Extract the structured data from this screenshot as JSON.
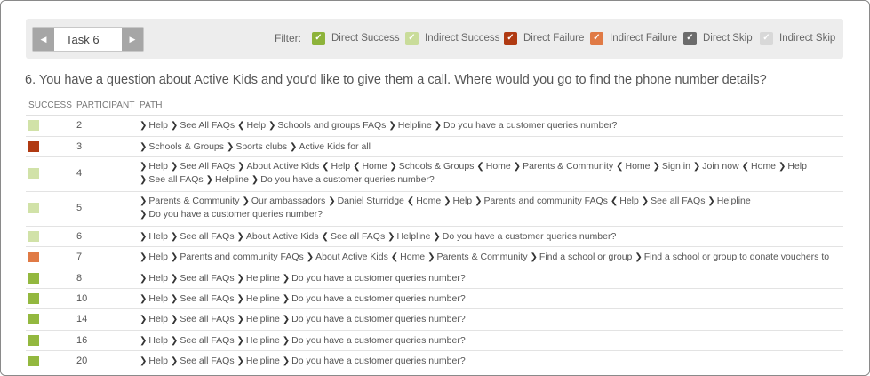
{
  "toolbar": {
    "prev_icon": "chevron-left-icon",
    "next_icon": "chevron-right-icon",
    "task_label": "Task 6",
    "filter_label": "Filter:",
    "filters": [
      {
        "label": "Direct Success",
        "color": "#8db33a",
        "checked": true
      },
      {
        "label": "Indirect Success",
        "color": "#c9dc9a",
        "checked": true
      },
      {
        "label": "Direct Failure",
        "color": "#b03a12",
        "checked": true
      },
      {
        "label": "Indirect Failure",
        "color": "#e07a45",
        "checked": true
      },
      {
        "label": "Direct Skip",
        "color": "#6b6b6b",
        "checked": true
      },
      {
        "label": "Indirect Skip",
        "color": "#d8d8d8",
        "checked": true
      }
    ]
  },
  "question": "6. You have a question about Active Kids and you'd like to give them a call. Where would you go to find the phone number details?",
  "table": {
    "headers": {
      "success": "SUCCESS",
      "participant": "PARTICIPANT",
      "path": "PATH"
    },
    "rows": [
      {
        "participant": "2",
        "success_color": "#d1e2a8",
        "path": [
          [
            ">",
            "Help"
          ],
          [
            ">",
            "See All FAQs"
          ],
          [
            "<",
            "Help"
          ],
          [
            ">",
            "Schools and groups FAQs"
          ],
          [
            ">",
            "Helpline"
          ],
          [
            ">",
            "Do you have a customer queries number?"
          ]
        ]
      },
      {
        "participant": "3",
        "success_color": "#b03a12",
        "path": [
          [
            ">",
            "Schools & Groups"
          ],
          [
            ">",
            "Sports clubs"
          ],
          [
            ">",
            "Active Kids for all"
          ]
        ]
      },
      {
        "participant": "4",
        "success_color": "#d1e2a8",
        "path": [
          [
            ">",
            "Help"
          ],
          [
            ">",
            "See All FAQs"
          ],
          [
            ">",
            "About Active Kids"
          ],
          [
            "<",
            "Help"
          ],
          [
            "<",
            "Home"
          ],
          [
            ">",
            "Schools & Groups"
          ],
          [
            "<",
            "Home"
          ],
          [
            ">",
            "Parents & Community"
          ],
          [
            "<",
            "Home"
          ],
          [
            ">",
            "Sign in"
          ],
          [
            ">",
            "Join now"
          ],
          [
            "<",
            "Home"
          ],
          [
            ">",
            "Help"
          ],
          [
            ">",
            "See all FAQs"
          ],
          [
            ">",
            "Helpline"
          ],
          [
            ">",
            "Do you have a customer queries number?"
          ]
        ]
      },
      {
        "participant": "5",
        "success_color": "#d1e2a8",
        "path": [
          [
            ">",
            "Parents & Community"
          ],
          [
            ">",
            "Our ambassadors"
          ],
          [
            ">",
            "Daniel Sturridge"
          ],
          [
            "<",
            "Home"
          ],
          [
            ">",
            "Help"
          ],
          [
            ">",
            "Parents and community FAQs"
          ],
          [
            "<",
            "Help"
          ],
          [
            ">",
            "See all FAQs"
          ],
          [
            ">",
            "Helpline"
          ],
          [
            ">",
            "Do you have a customer queries number?"
          ]
        ]
      },
      {
        "participant": "6",
        "success_color": "#d1e2a8",
        "path": [
          [
            ">",
            "Help"
          ],
          [
            ">",
            "See all FAQs"
          ],
          [
            ">",
            "About Active Kids"
          ],
          [
            "<",
            "See all FAQs"
          ],
          [
            ">",
            "Helpline"
          ],
          [
            ">",
            "Do you have a customer queries number?"
          ]
        ]
      },
      {
        "participant": "7",
        "success_color": "#e07a45",
        "path": [
          [
            ">",
            "Help"
          ],
          [
            ">",
            "Parents and community FAQs"
          ],
          [
            ">",
            "About Active Kids"
          ],
          [
            "<",
            "Home"
          ],
          [
            ">",
            "Parents & Community"
          ],
          [
            ">",
            "Find a school or group"
          ],
          [
            ">",
            "Find a school or group to donate vouchers to"
          ]
        ]
      },
      {
        "participant": "8",
        "success_color": "#93b83f",
        "path": [
          [
            ">",
            "Help"
          ],
          [
            ">",
            "See all FAQs"
          ],
          [
            ">",
            "Helpline"
          ],
          [
            ">",
            "Do you have a customer queries number?"
          ]
        ]
      },
      {
        "participant": "10",
        "success_color": "#93b83f",
        "path": [
          [
            ">",
            "Help"
          ],
          [
            ">",
            "See all FAQs"
          ],
          [
            ">",
            "Helpline"
          ],
          [
            ">",
            "Do you have a customer queries number?"
          ]
        ]
      },
      {
        "participant": "14",
        "success_color": "#93b83f",
        "path": [
          [
            ">",
            "Help"
          ],
          [
            ">",
            "See all FAQs"
          ],
          [
            ">",
            "Helpline"
          ],
          [
            ">",
            "Do you have a customer queries number?"
          ]
        ]
      },
      {
        "participant": "16",
        "success_color": "#93b83f",
        "path": [
          [
            ">",
            "Help"
          ],
          [
            ">",
            "See all FAQs"
          ],
          [
            ">",
            "Helpline"
          ],
          [
            ">",
            "Do you have a customer queries number?"
          ]
        ]
      },
      {
        "participant": "20",
        "success_color": "#93b83f",
        "path": [
          [
            ">",
            "Help"
          ],
          [
            ">",
            "See all FAQs"
          ],
          [
            ">",
            "Helpline"
          ],
          [
            ">",
            "Do you have a customer queries number?"
          ]
        ]
      }
    ]
  }
}
